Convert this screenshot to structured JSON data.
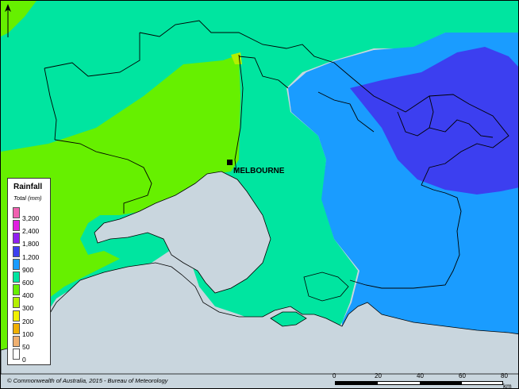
{
  "map": {
    "city": {
      "name": "MELBOURNE"
    },
    "colors": {
      "ocean": "#c9d6de",
      "band_600_900": "#00e5a0",
      "band_400_600": "#66f000",
      "band_900_1200": "#1a9cff",
      "band_1200_1800": "#3c3ff0",
      "band_300_400": "#b4f000",
      "boundary": "#000000"
    }
  },
  "legend": {
    "title": "Rainfall",
    "subtitle": "Total (mm)",
    "items": [
      {
        "label": "3,200",
        "color": "#f060b0"
      },
      {
        "label": "2,400",
        "color": "#e020e0"
      },
      {
        "label": "1,800",
        "color": "#9020f0"
      },
      {
        "label": "1,200",
        "color": "#3c3ff0"
      },
      {
        "label": "900",
        "color": "#1a9cff"
      },
      {
        "label": "600",
        "color": "#00e5a0"
      },
      {
        "label": "400",
        "color": "#66f000"
      },
      {
        "label": "300",
        "color": "#b4f000"
      },
      {
        "label": "200",
        "color": "#f0f000"
      },
      {
        "label": "100",
        "color": "#f0b000"
      },
      {
        "label": "50",
        "color": "#f0b070"
      },
      {
        "label": "0",
        "color": "#ffffff"
      }
    ]
  },
  "scale": {
    "ticks": [
      "0",
      "20",
      "40",
      "60",
      "80"
    ],
    "unit": "km"
  },
  "footer": {
    "copyright": "© Commonwealth of Australia, 2015 - Bureau of Meteorology"
  }
}
